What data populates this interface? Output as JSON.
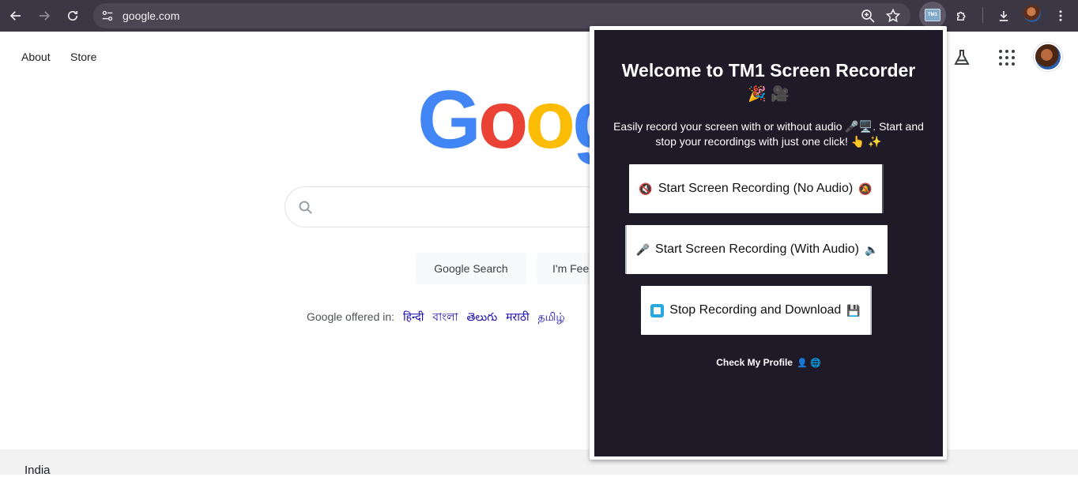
{
  "browser": {
    "url": "google.com",
    "extension_icon_text": "TM1"
  },
  "google": {
    "links": {
      "about": "About",
      "store": "Store"
    },
    "logo_letters": [
      "G",
      "o",
      "o",
      "g"
    ],
    "buttons": {
      "search": "Google Search",
      "lucky": "I'm Fee"
    },
    "offered_in_label": "Google offered in:",
    "languages": [
      "हिन्दी",
      "বাংলা",
      "తెలుగు",
      "मराठी",
      "தமிழ்"
    ],
    "footer_country": "India"
  },
  "popup": {
    "title": "Welcome to TM1 Screen Recorder",
    "title_emoji": "🎉 🎥",
    "description": "Easily record your screen with or without audio 🎤🖥️. Start and stop your recordings with just one click! 👆 ✨",
    "buttons": {
      "no_audio": {
        "lead": "🔇",
        "label": "Start Screen Recording (No Audio)",
        "trail": "🔕"
      },
      "with_audio": {
        "lead": "🎤",
        "label": "Start Screen Recording (With Audio)",
        "trail": "🔈"
      },
      "stop": {
        "label": "Stop Recording and Download",
        "trail": "💾"
      }
    },
    "profile_link": {
      "label": "Check My Profile",
      "icons": "👤 🌐"
    }
  },
  "colors": {
    "toolbar": "#3c3744",
    "popup_bg": "#1e1a28",
    "stop_icon": "#29a8e0",
    "link": "#1a0dab"
  }
}
